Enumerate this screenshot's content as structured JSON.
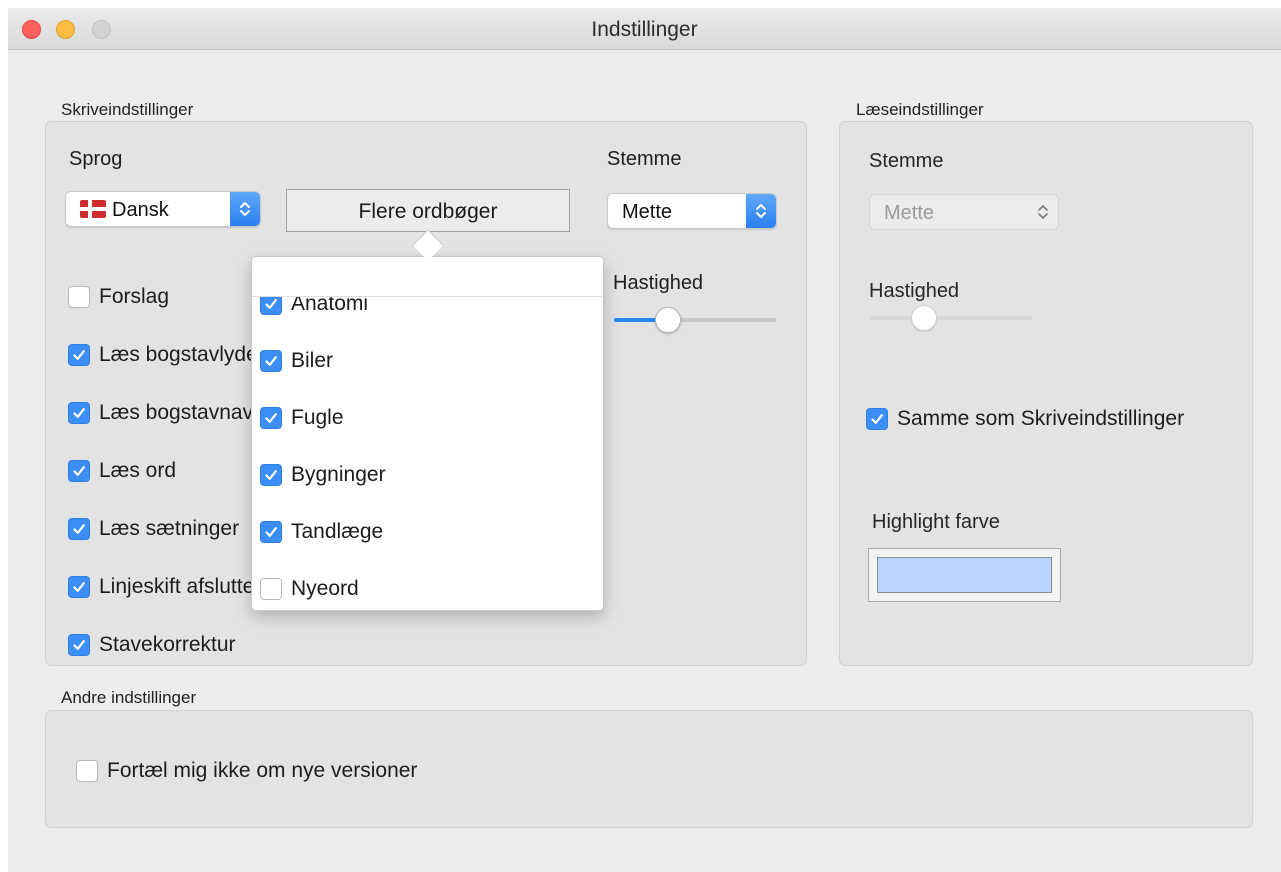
{
  "window": {
    "title": "Indstillinger"
  },
  "writing": {
    "group_label": "Skriveindstillinger",
    "language_heading": "Sprog",
    "language_value": "Dansk",
    "more_dictionaries_label": "Flere ordbøger",
    "voice_heading": "Stemme",
    "voice_value": "Mette",
    "speed_heading": "Hastighed",
    "speed_level": 0.3,
    "options": [
      {
        "label": "Forslag",
        "checked": false
      },
      {
        "label": "Læs bogstavlyde",
        "checked": true
      },
      {
        "label": "Læs bogstavnavne",
        "checked": true
      },
      {
        "label": "Læs ord",
        "checked": true
      },
      {
        "label": "Læs sætninger",
        "checked": true
      },
      {
        "label": "Linjeskift afslutter sætning",
        "checked": true
      },
      {
        "label": "Stavekorrektur",
        "checked": true
      }
    ]
  },
  "dictionaries_popover": {
    "search_value": "",
    "items": [
      {
        "label": "Anatomi",
        "checked": true
      },
      {
        "label": "Biler",
        "checked": true
      },
      {
        "label": "Fugle",
        "checked": true
      },
      {
        "label": "Bygninger",
        "checked": true
      },
      {
        "label": "Tandlæge",
        "checked": true
      },
      {
        "label": "Nyeord",
        "checked": false
      }
    ]
  },
  "reading": {
    "group_label": "Læseindstillinger",
    "voice_heading": "Stemme",
    "voice_value": "Mette",
    "speed_heading": "Hastighed",
    "speed_level": 0.3,
    "same_as_writing_label": "Samme som Skriveindstillinger",
    "same_as_writing_checked": true,
    "highlight_heading": "Highlight farve",
    "highlight_color": "#b8d6fd"
  },
  "other": {
    "group_label": "Andre indstillinger",
    "no_updates_label": "Fortæl mig ikke om nye versioner",
    "no_updates_checked": false
  },
  "colors": {
    "accent": "#2d86f5",
    "background": "#ececec"
  }
}
